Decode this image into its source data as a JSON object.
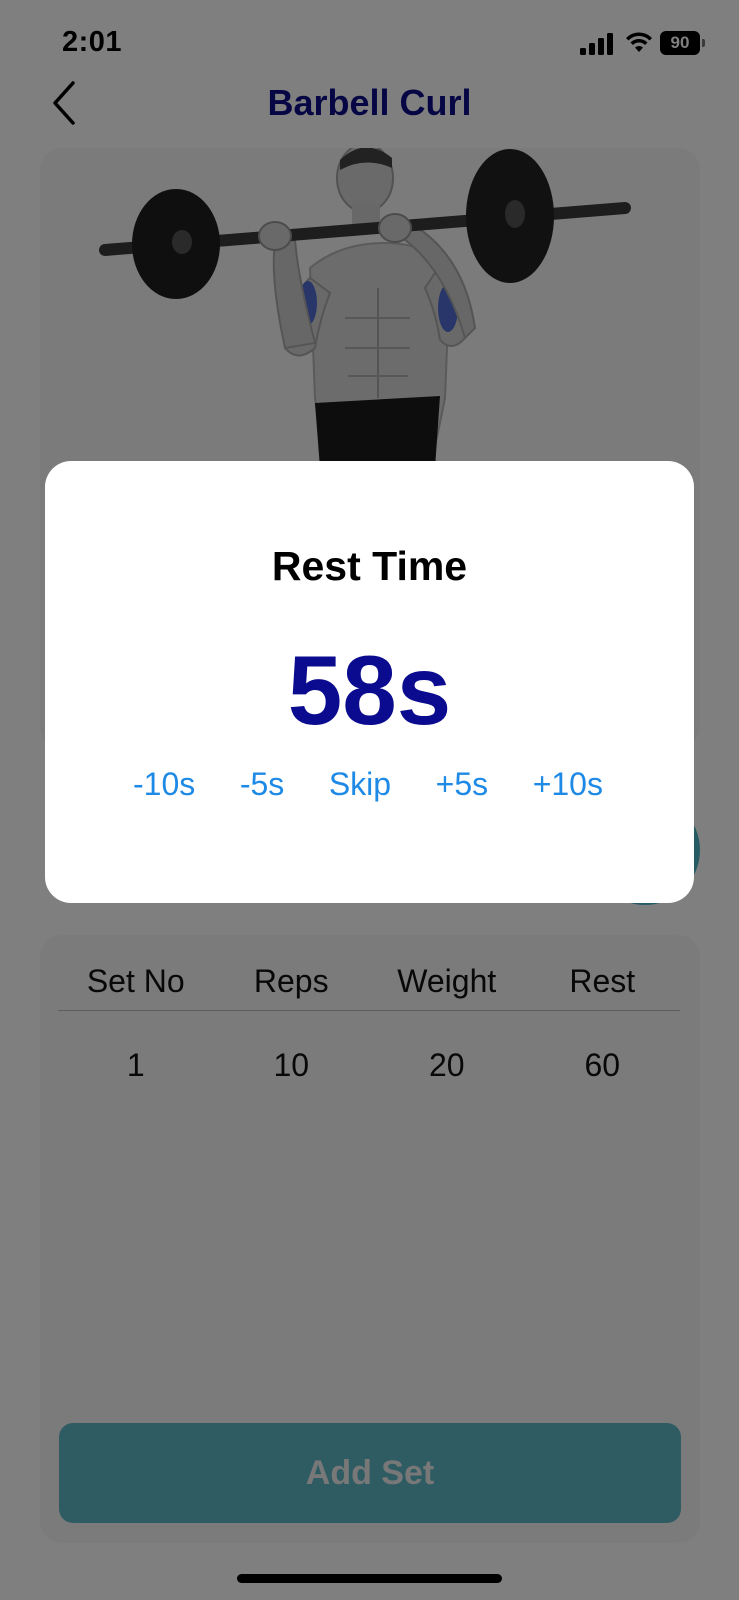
{
  "status_bar": {
    "time": "2:01",
    "battery": "90"
  },
  "header": {
    "title": "Barbell Curl"
  },
  "sets_table": {
    "columns": [
      "Set No",
      "Reps",
      "Weight",
      "Rest"
    ],
    "rows": [
      {
        "set_no": "1",
        "reps": "10",
        "weight": "20",
        "rest": "60"
      }
    ],
    "add_button_label": "Add Set"
  },
  "rest_modal": {
    "title": "Rest Time",
    "countdown": "58s",
    "actions": [
      "-10s",
      "-5s",
      "Skip",
      "+5s",
      "+10s"
    ]
  },
  "colors": {
    "title_navy": "#0d0d8a",
    "countdown_navy": "#0b0b8f",
    "action_blue": "#1e8ae6",
    "accent_teal": "#5fb8c6",
    "highlight_muscle_blue": "#3b5cd6"
  },
  "icons": [
    "back-chevron-icon",
    "cellular-signal-icon",
    "wifi-icon",
    "battery-icon"
  ]
}
